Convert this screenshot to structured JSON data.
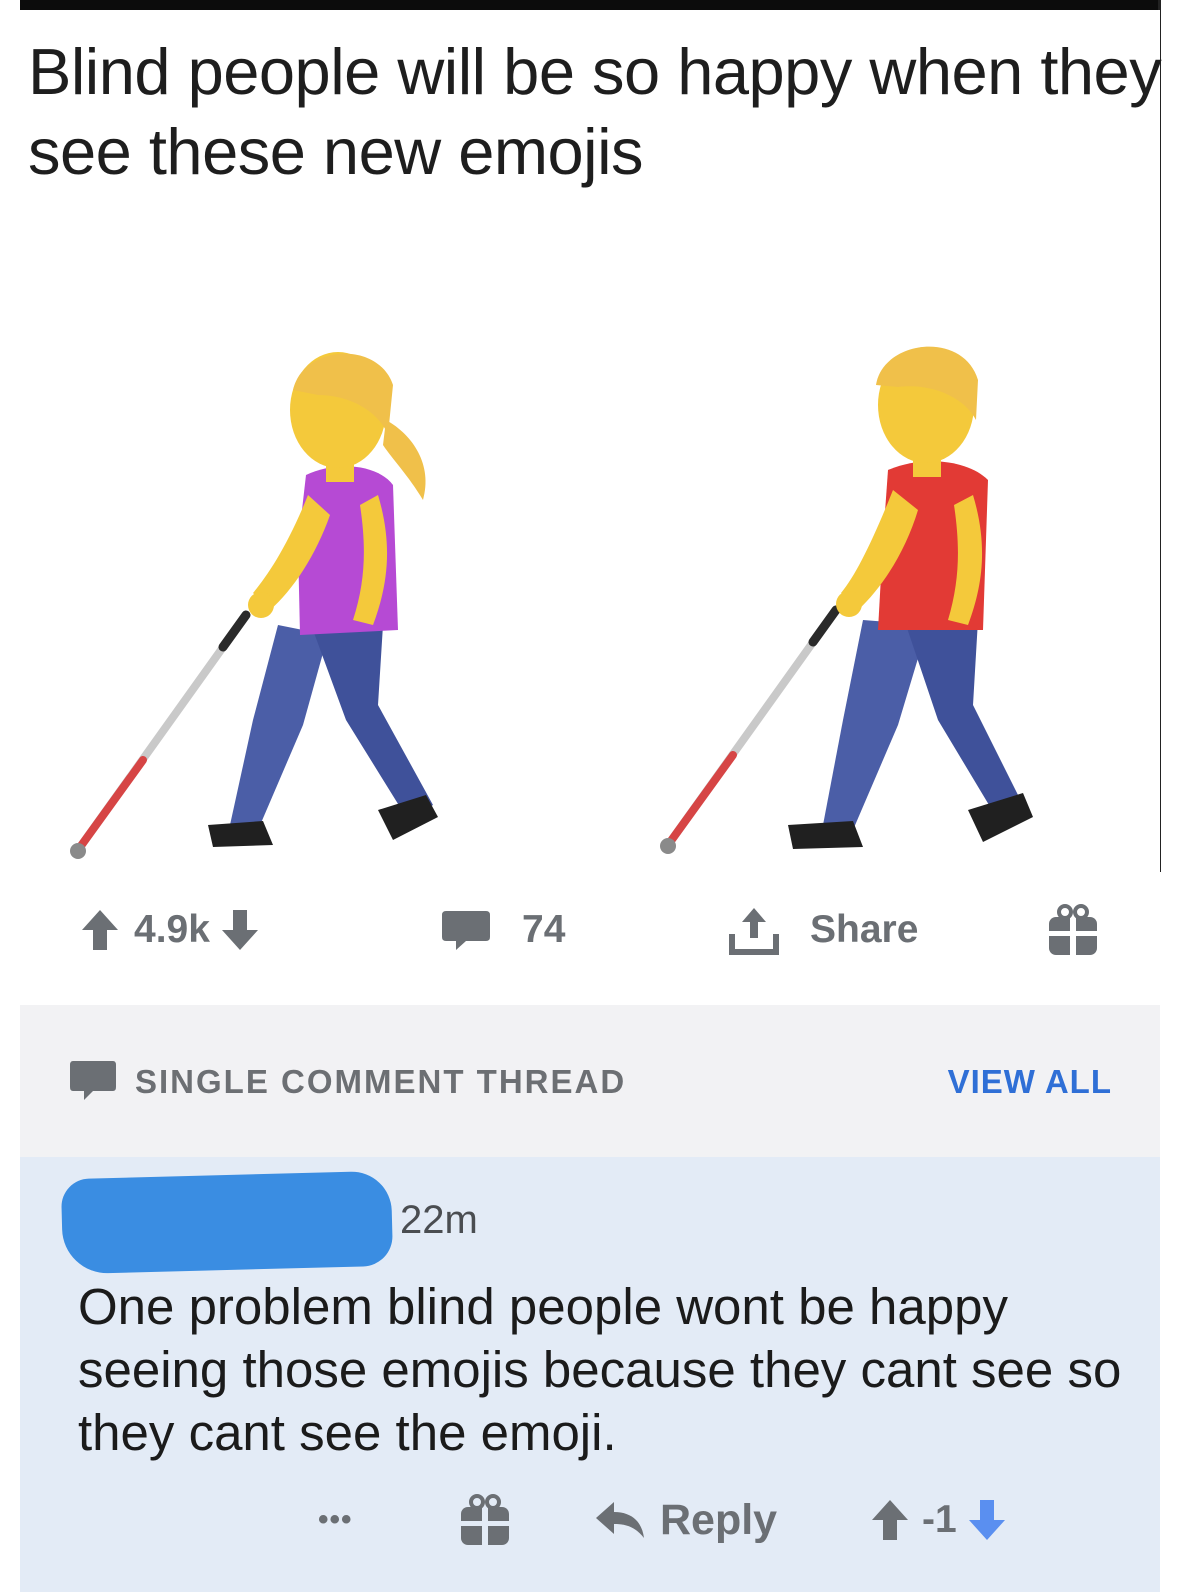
{
  "post": {
    "meme_caption": "Blind people will be so happy when they see these new emojis",
    "emojis": [
      "woman-with-white-cane-icon",
      "man-with-white-cane-icon"
    ]
  },
  "actions": {
    "score": "4.9k",
    "comments": "74",
    "share_label": "Share"
  },
  "thread": {
    "header_label": "SINGLE COMMENT THREAD",
    "view_all_label": "VIEW ALL"
  },
  "comment": {
    "timestamp": "22m",
    "body": "One problem blind people wont be happy seeing those emojis because they cant see so they cant see the emoji.",
    "more_label": "•••",
    "reply_label": "Reply",
    "score": "-1"
  },
  "colors": {
    "accent_blue": "#2f6fd6",
    "comment_bg": "#e3ebf6",
    "thread_header_bg": "#f2f2f4",
    "redaction_blue": "#3a8de2"
  }
}
